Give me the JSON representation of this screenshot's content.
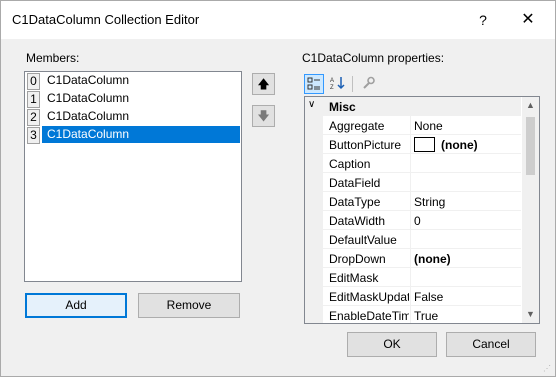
{
  "window": {
    "title": "C1DataColumn Collection Editor",
    "help_label": "?",
    "close_label": "✕"
  },
  "members": {
    "label": "Members:",
    "items": [
      {
        "index": "0",
        "name": "C1DataColumn"
      },
      {
        "index": "1",
        "name": "C1DataColumn"
      },
      {
        "index": "2",
        "name": "C1DataColumn"
      },
      {
        "index": "3",
        "name": "C1DataColumn",
        "selected": true
      }
    ],
    "up_icon": "🡅",
    "down_icon": "🡇",
    "add_label": "Add",
    "remove_label": "Remove"
  },
  "properties": {
    "label": "C1DataColumn properties:",
    "toolbar": {
      "categorized_icon": "categorized-icon",
      "alphabetical_icon": "alphabetical-icon",
      "property_pages_icon": "wrench-icon"
    },
    "category": "Misc",
    "rows": [
      {
        "name": "Aggregate",
        "value": "None"
      },
      {
        "name": "ButtonPicture",
        "value": "(none)",
        "bold": true,
        "swatch": true
      },
      {
        "name": "Caption",
        "value": ""
      },
      {
        "name": "DataField",
        "value": ""
      },
      {
        "name": "DataType",
        "value": "String"
      },
      {
        "name": "DataWidth",
        "value": "0"
      },
      {
        "name": "DefaultValue",
        "value": ""
      },
      {
        "name": "DropDown",
        "value": "(none)",
        "bold": true
      },
      {
        "name": "EditMask",
        "value": ""
      },
      {
        "name": "EditMaskUpdat",
        "value": "False"
      },
      {
        "name": "EnableDateTim",
        "value": "True"
      }
    ]
  },
  "buttons": {
    "ok_label": "OK",
    "cancel_label": "Cancel"
  },
  "colors": {
    "selection": "#0078d7",
    "window_bg": "#f0f0f0"
  }
}
